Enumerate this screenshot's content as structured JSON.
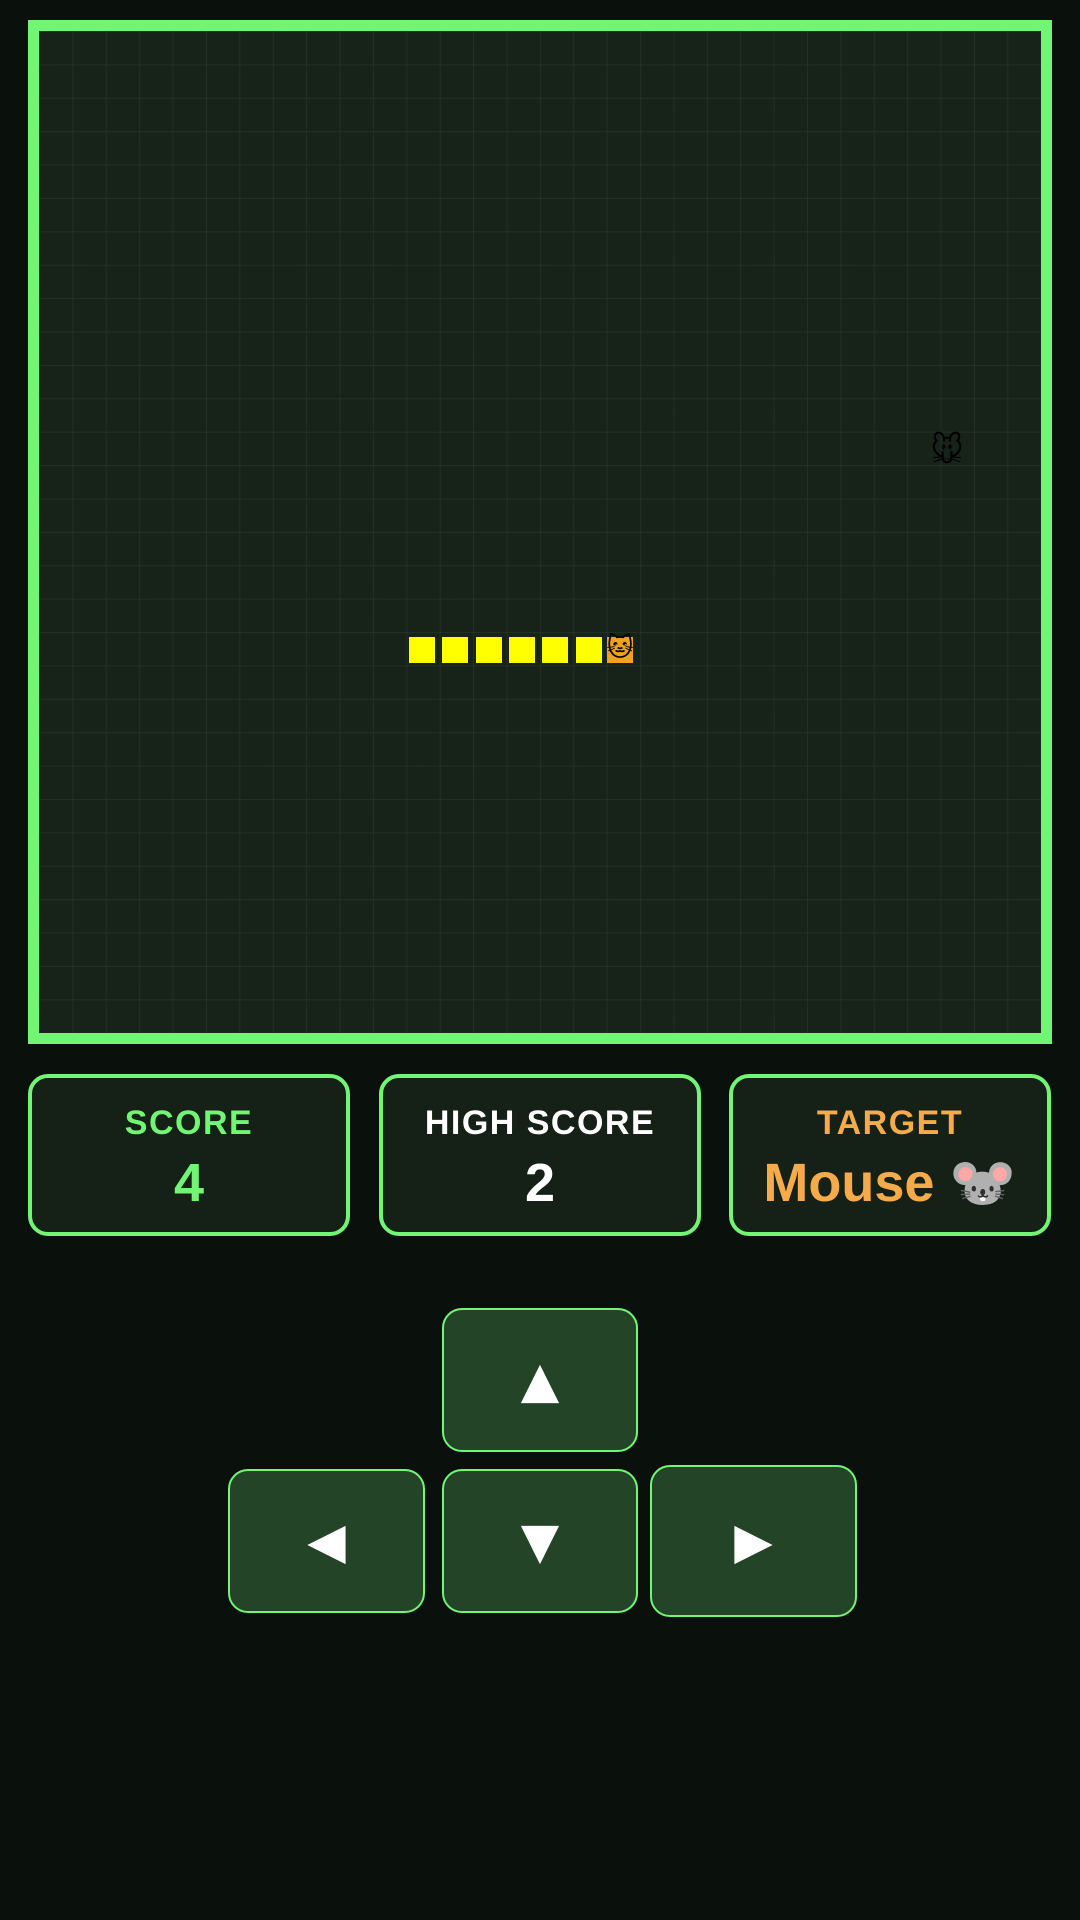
{
  "game": {
    "snake": {
      "head_icon": "cat-face-emoji",
      "head_glyph": "🐱",
      "body_length": 6,
      "direction": "right"
    },
    "target_icon": "mouse-face-emoji",
    "target_glyph": "🐭"
  },
  "stats": {
    "score_label": "SCORE",
    "score_value": "4",
    "high_score_label": "HIGH SCORE",
    "high_score_value": "2",
    "target_label": "TARGET",
    "target_value": "Mouse 🐭"
  },
  "controls": {
    "up": "▲",
    "down": "▼",
    "left": "◀",
    "right": "▶"
  },
  "colors": {
    "accent_green": "#72f574",
    "snake_body": "#ffff00",
    "target_orange": "#f6ab4a",
    "board_bg": "#172319",
    "page_bg": "#0a110c",
    "button_bg": "#234426"
  }
}
